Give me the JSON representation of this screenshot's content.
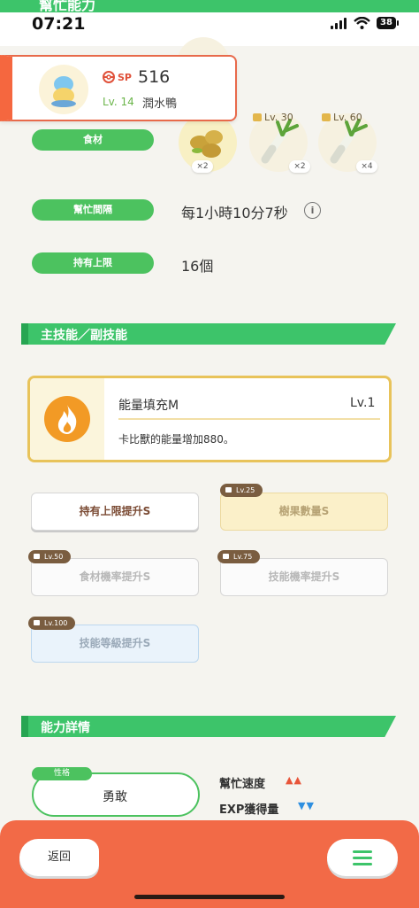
{
  "status_bar": {
    "time": "07:21",
    "battery": "38"
  },
  "header": {
    "partial_title": "幫忙能力"
  },
  "pokemon": {
    "sp_label": "SP",
    "sp_value": "516",
    "level": "Lv. 14",
    "name": "潤水鴨"
  },
  "help_info": {
    "ingredients_label": "食材",
    "ingredients": [
      {
        "name": "ingredient-soybeans",
        "qty": "×2",
        "unlock": ""
      },
      {
        "name": "ingredient-leek",
        "qty": "×2",
        "unlock": "Lv. 30"
      },
      {
        "name": "ingredient-leek",
        "qty": "×4",
        "unlock": "Lv. 60"
      }
    ],
    "interval_label": "幫忙間隔",
    "interval_value": "每1小時10分7秒",
    "capacity_label": "持有上限",
    "capacity_value": "16個"
  },
  "skills_section": {
    "title": "主技能／副技能",
    "main_skill": {
      "name": "能量填充M",
      "level": "Lv.1",
      "description": "卡比獸的能量增加880。"
    },
    "sub_skills": [
      {
        "label": "持有上限提升S",
        "unlock": "",
        "state": "active"
      },
      {
        "label": "樹果數量S",
        "unlock": "Lv.25",
        "state": "gold"
      },
      {
        "label": "食材機率提升S",
        "unlock": "Lv.50",
        "state": "locked"
      },
      {
        "label": "技能機率提升S",
        "unlock": "Lv.75",
        "state": "locked"
      },
      {
        "label": "技能等級提升S",
        "unlock": "Lv.100",
        "state": "blue"
      }
    ]
  },
  "ability_section": {
    "title": "能力詳情",
    "nature_tag": "性格",
    "nature_value": "勇敢",
    "stats": [
      {
        "label": "幫忙速度",
        "arrows": "▲▲",
        "color": "#e8553a"
      },
      {
        "label": "EXP獲得量",
        "arrows": "▼▼",
        "color": "#2e8fe0"
      }
    ]
  },
  "bottom_bar": {
    "back_label": "返回"
  },
  "colors": {
    "accent_green": "#3dc46a",
    "accent_orange": "#f26a47"
  }
}
